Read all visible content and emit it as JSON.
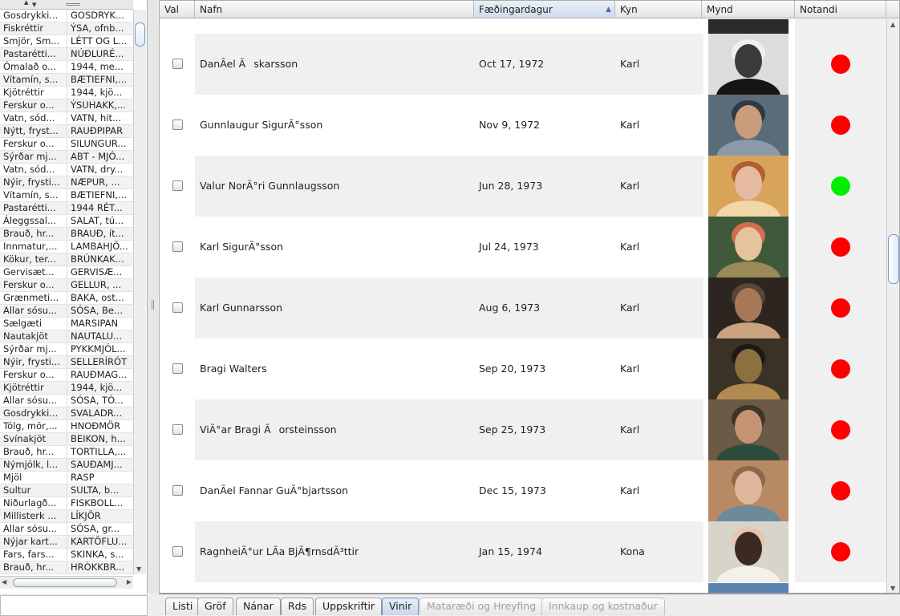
{
  "left_panel": {
    "rows": [
      [
        "Gosdrykki...",
        "GOSDRYK..."
      ],
      [
        "Fiskréttir",
        "ÝSA, ofnb..."
      ],
      [
        "Smjör, Sm...",
        "LÉTT OG L..."
      ],
      [
        "Pastarétti...",
        "NÚÐLURÉ..."
      ],
      [
        "Ómalað o...",
        "1944, me..."
      ],
      [
        "Vítamín, s...",
        "BÆTIEFNI,..."
      ],
      [
        "Kjötréttir",
        "1944, kjö..."
      ],
      [
        "Ferskur o...",
        "ÝSUHAKK,..."
      ],
      [
        "Vatn, sód...",
        "VATN, hit..."
      ],
      [
        "Nýtt, fryst...",
        "RAUÐPIPAR"
      ],
      [
        "Ferskur o...",
        "SILUNGUR..."
      ],
      [
        "Sýrðar mj...",
        "ABT - MJÓ..."
      ],
      [
        "Vatn, sód...",
        "VATN, dry..."
      ],
      [
        "Nýir, frysti...",
        "NÆPUR, ..."
      ],
      [
        "Vítamín, s...",
        "BÆTIEFNI,..."
      ],
      [
        "Pastarétti...",
        "1944 RÉT..."
      ],
      [
        "Áleggssal...",
        "SALAT, tú..."
      ],
      [
        "Brauð, hr...",
        "BRAUÐ, ít..."
      ],
      [
        "Innmatur,...",
        "LAMBAHJÖ..."
      ],
      [
        "Kökur, ter...",
        "BRÚNKAK..."
      ],
      [
        "Gervisæt...",
        "GERVISÆ..."
      ],
      [
        "Ferskur o...",
        "GELLUR, ..."
      ],
      [
        "Grænmeti...",
        "BAKA, ost..."
      ],
      [
        "Allar sósu...",
        "SÓSA, Be..."
      ],
      [
        "Sælgæti",
        "MARSIPAN"
      ],
      [
        "Nautakjöt",
        "NAUTALU..."
      ],
      [
        "Sýrðar mj...",
        "PYKKMJÓL..."
      ],
      [
        "Nýir, frysti...",
        "SELLERÍRÓT"
      ],
      [
        "Ferskur o...",
        "RAUÐMAG..."
      ],
      [
        "Kjötréttir",
        "1944, kjö..."
      ],
      [
        "Allar sósu...",
        "SÓSA, TÓ..."
      ],
      [
        "Gosdrykki...",
        "SVALADR..."
      ],
      [
        "Tólg, mör,...",
        "HNOÐMÖR"
      ],
      [
        "Svínakjöt",
        "BEIKON, h..."
      ],
      [
        "Brauð, hr...",
        "TORTILLA,..."
      ],
      [
        "Nýmjólk, l...",
        "SAUÐAMJ..."
      ],
      [
        "Mjöl",
        "RASP"
      ],
      [
        "Sultur",
        "SULTA, b..."
      ],
      [
        "Niðurlagð...",
        "FISKBOLL..."
      ],
      [
        "Millisterk ...",
        "LÍKJÖR"
      ],
      [
        "Allar sósu...",
        "SÓSA, gr..."
      ],
      [
        "Nýjar kart...",
        "KARTÖFLU..."
      ],
      [
        "Fars, fars...",
        "SKINKA, s..."
      ],
      [
        "Brauð, hr...",
        "HRÓKKBR..."
      ]
    ]
  },
  "table": {
    "columns": {
      "val": "Val",
      "nafn": "Nafn",
      "dob": "Fæðingardagur",
      "kyn": "Kyn",
      "mynd": "Mynd",
      "notandi": "Notandi"
    },
    "sorted_column": "Fæðingardagur",
    "rows": [
      {
        "name": "DanÃ­el Ãskarsson",
        "dob": "Oct 17, 1972",
        "kyn": "Karl",
        "status": "red"
      },
      {
        "name": "Gunnlaugur SigurÃ°sson",
        "dob": "Nov 9, 1972",
        "kyn": "Karl",
        "status": "red"
      },
      {
        "name": "Valur NorÃ°ri Gunnlaugsson",
        "dob": "Jun 28, 1973",
        "kyn": "Karl",
        "status": "green"
      },
      {
        "name": "Karl SigurÃ°sson",
        "dob": "Jul 24, 1973",
        "kyn": "Karl",
        "status": "red"
      },
      {
        "name": "Karl Gunnarsson",
        "dob": "Aug 6, 1973",
        "kyn": "Karl",
        "status": "red"
      },
      {
        "name": "Bragi Walters",
        "dob": "Sep 20, 1973",
        "kyn": "Karl",
        "status": "red"
      },
      {
        "name": "ViÃ°ar Bragi Ãorsteinsson",
        "dob": "Sep 25, 1973",
        "kyn": "Karl",
        "status": "red"
      },
      {
        "name": "DanÃ­el Fannar GuÃ°bjartsson",
        "dob": "Dec 15, 1973",
        "kyn": "Karl",
        "status": "red"
      },
      {
        "name": "RagnheiÃ°ur LÃ­a BjÃ¶rnsdÃ³ttir",
        "dob": "Jan 15, 1974",
        "kyn": "Kona",
        "status": "red"
      }
    ]
  },
  "status_colors": {
    "red": "#ff0000",
    "green": "#00ee00"
  },
  "tabs": [
    {
      "label": "Listi",
      "state": "normal"
    },
    {
      "label": "Gröf",
      "state": "normal"
    },
    {
      "label": "Nánar",
      "state": "normal"
    },
    {
      "label": "Rds",
      "state": "normal"
    },
    {
      "label": "Uppskriftir",
      "state": "normal"
    },
    {
      "label": "Vinir",
      "state": "active"
    },
    {
      "label": "Mataræði og Hreyfing",
      "state": "disabled"
    },
    {
      "label": "Innkaup og kostnaður",
      "state": "disabled"
    }
  ],
  "icons": {
    "sort": "sort-ascending-icon",
    "status": "status-dot-icon",
    "photo": "avatar-photo"
  }
}
